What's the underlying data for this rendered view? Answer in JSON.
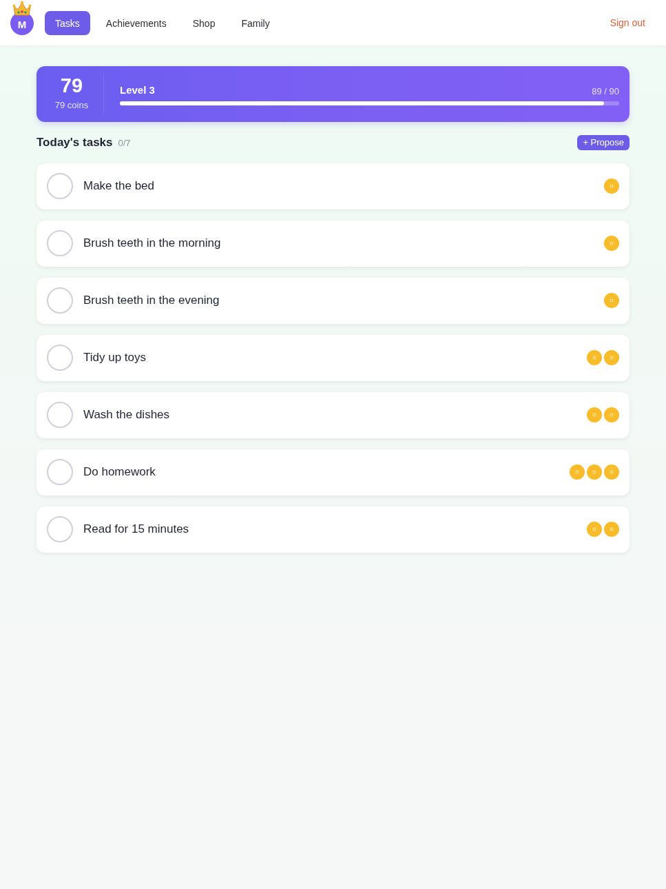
{
  "nav": {
    "avatar": {
      "initial": "M"
    },
    "tabs": [
      {
        "label": "Tasks",
        "selected": true
      },
      {
        "label": "Achievements",
        "selected": false
      },
      {
        "label": "Shop",
        "selected": false
      },
      {
        "label": "Family",
        "selected": false
      }
    ],
    "sign_out": "Sign out"
  },
  "summary": {
    "coins": "79",
    "coins_label": "79 coins",
    "level_label": "Level 3",
    "progress_text": "89 / 90",
    "level": 0.97
  },
  "tasks_header": {
    "title": "Today's tasks",
    "count": "0/7",
    "propose_button": "+ Propose"
  },
  "tasks": [
    {
      "title": "Make the bed",
      "checked": false,
      "rewards": [
        {
          "kind": "coin"
        }
      ]
    },
    {
      "title": "Brush teeth in the morning",
      "checked": false,
      "rewards": [
        {
          "kind": "coin"
        }
      ]
    },
    {
      "title": "Brush teeth in the evening",
      "checked": false,
      "rewards": [
        {
          "kind": "coin"
        }
      ]
    },
    {
      "title": "Tidy up toys",
      "checked": false,
      "rewards": [
        {
          "kind": "coin"
        },
        {
          "kind": "coin"
        }
      ]
    },
    {
      "title": "Wash the dishes",
      "checked": false,
      "rewards": [
        {
          "kind": "coin"
        },
        {
          "kind": "coin"
        }
      ]
    },
    {
      "title": "Do homework",
      "checked": false,
      "rewards": [
        {
          "kind": "coin"
        },
        {
          "kind": "coin"
        },
        {
          "kind": "coin"
        }
      ]
    },
    {
      "title": "Read for 15 minutes",
      "checked": false,
      "rewards": [
        {
          "kind": "coin"
        },
        {
          "kind": "coin"
        }
      ]
    }
  ]
}
